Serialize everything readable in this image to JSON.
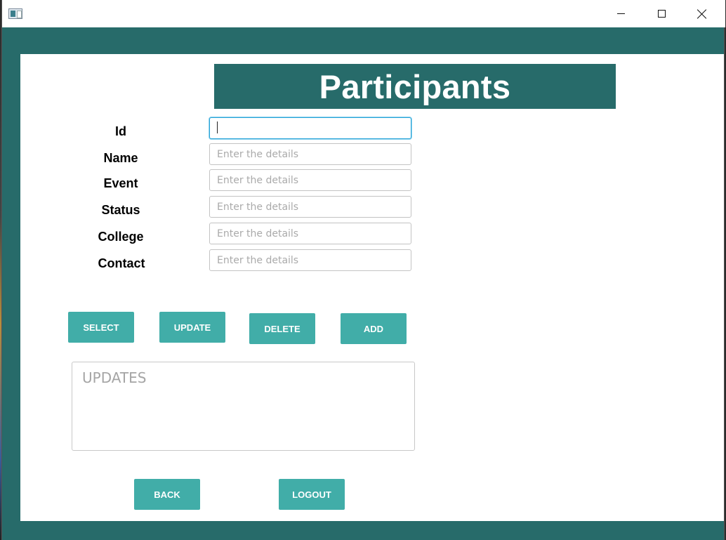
{
  "window": {
    "controls": {
      "minimize_icon": "minimize-icon",
      "maximize_icon": "maximize-icon",
      "close_icon": "close-icon"
    },
    "colors": {
      "frame": "#276b6a",
      "button": "#41ada8",
      "content": "#ffffff"
    }
  },
  "header": {
    "title": "Participants"
  },
  "form": {
    "fields": [
      {
        "label": "Id",
        "value": "",
        "placeholder": ""
      },
      {
        "label": "Name",
        "value": "",
        "placeholder": "Enter the details"
      },
      {
        "label": "Event",
        "value": "",
        "placeholder": "Enter the details"
      },
      {
        "label": "Status",
        "value": "",
        "placeholder": "Enter the details"
      },
      {
        "label": "College",
        "value": "",
        "placeholder": "Enter the details"
      },
      {
        "label": "Contact",
        "value": "",
        "placeholder": "Enter the details"
      }
    ]
  },
  "actions": {
    "select": "SELECT",
    "update": "UPDATE",
    "delete": "DELETE",
    "add": "ADD"
  },
  "updates_area": {
    "placeholder": "UPDATES"
  },
  "footer": {
    "back": "BACK",
    "logout": "LOGOUT"
  }
}
